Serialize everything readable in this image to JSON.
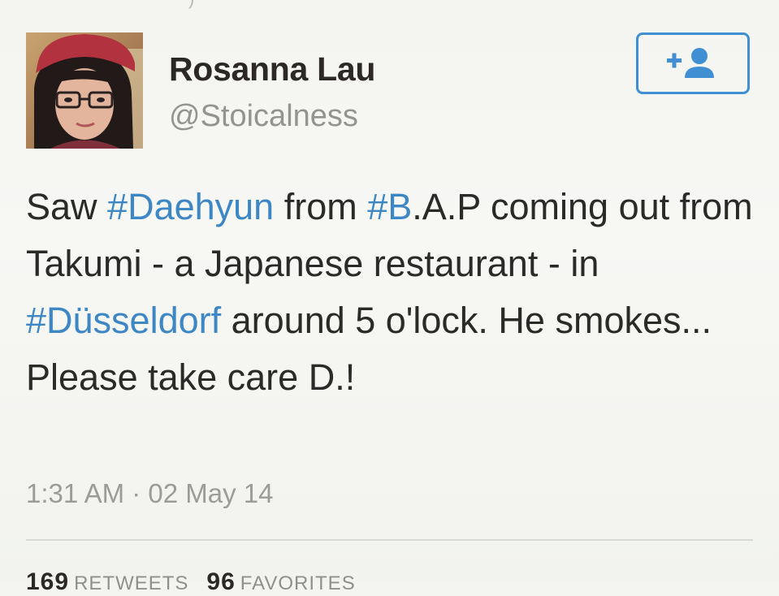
{
  "top_fragment": ")",
  "profile": {
    "name": "Rosanna Lau",
    "handle": "@Stoicalness",
    "avatar_icon": "profile-photo"
  },
  "follow_button": {
    "icon": "add-user-icon",
    "color": "#3f8fd2"
  },
  "tweet": {
    "segments": [
      {
        "text": "Saw ",
        "hashtag": false
      },
      {
        "text": "#Daehyun",
        "hashtag": true
      },
      {
        "text": " from ",
        "hashtag": false
      },
      {
        "text": "#B",
        "hashtag": true
      },
      {
        "text": ".A.P coming out from Takumi - a Japanese restaurant - in ",
        "hashtag": false
      },
      {
        "text": "#Düsseldorf",
        "hashtag": true
      },
      {
        "text": " around 5 o'lock. He smokes... Please take care D.!",
        "hashtag": false
      }
    ],
    "hashtag_color": "#3d87c4"
  },
  "timestamp": "1:31 AM · 02 May 14",
  "stats": {
    "retweets_count": "169",
    "retweets_label": "RETWEETS",
    "favorites_count": "96",
    "favorites_label": "FAVORITES"
  }
}
